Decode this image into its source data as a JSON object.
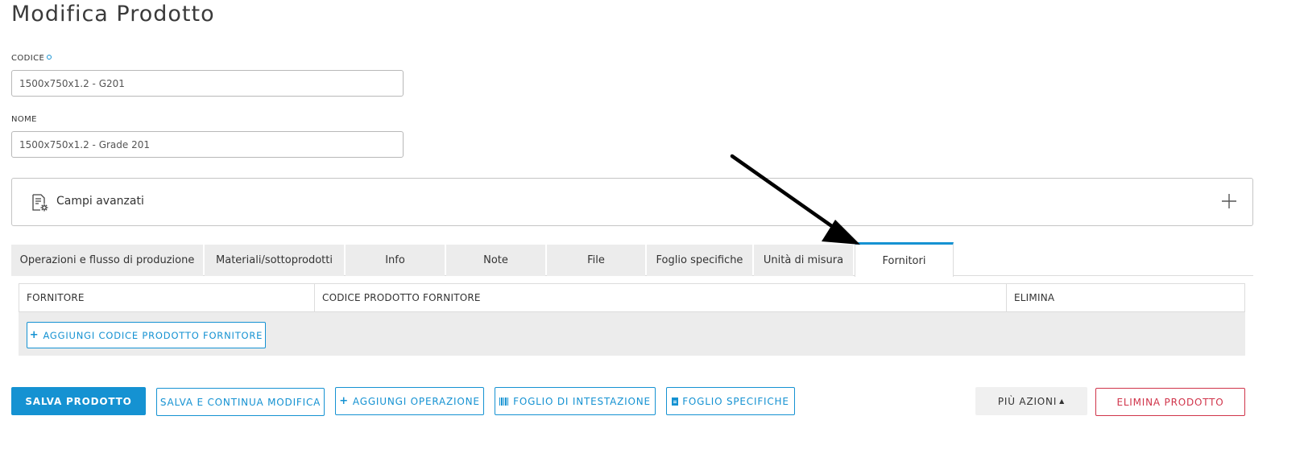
{
  "page": {
    "title": "Modifica Prodotto"
  },
  "form": {
    "code_label": "CODICE",
    "code_value": "1500x750x1.2 - G201",
    "name_label": "NOME",
    "name_value": "1500x750x1.2 - Grade 201"
  },
  "advanced": {
    "label": "Campi avanzati",
    "icon": "settings-document-icon",
    "toggle_icon": "plus-icon"
  },
  "tabs": [
    {
      "label": "Operazioni e flusso di produzione"
    },
    {
      "label": "Materiali/sottoprodotti"
    },
    {
      "label": "Info"
    },
    {
      "label": "Note"
    },
    {
      "label": "File"
    },
    {
      "label": "Foglio specifiche"
    },
    {
      "label": "Unità di misura"
    },
    {
      "label": "Fornitori",
      "active": true
    }
  ],
  "suppliers_table": {
    "columns": [
      "FORNITORE",
      "CODICE PRODOTTO FORNITORE",
      "ELIMINA"
    ],
    "add_button": "AGGIUNGI CODICE PRODOTTO FORNITORE"
  },
  "actions": {
    "save": "SALVA PRODOTTO",
    "save_continue": "SALVA E CONTINUA MODIFICA",
    "add_operation": "AGGIUNGI OPERAZIONE",
    "header_sheet": "FOGLIO DI INTESTAZIONE",
    "spec_sheet": "FOGLIO SPECIFICHE",
    "more": "PIÙ AZIONI",
    "delete": "ELIMINA PRODOTTO"
  },
  "colors": {
    "accent": "#1592d2",
    "danger": "#d0344a",
    "tab_bg": "#ececec"
  }
}
